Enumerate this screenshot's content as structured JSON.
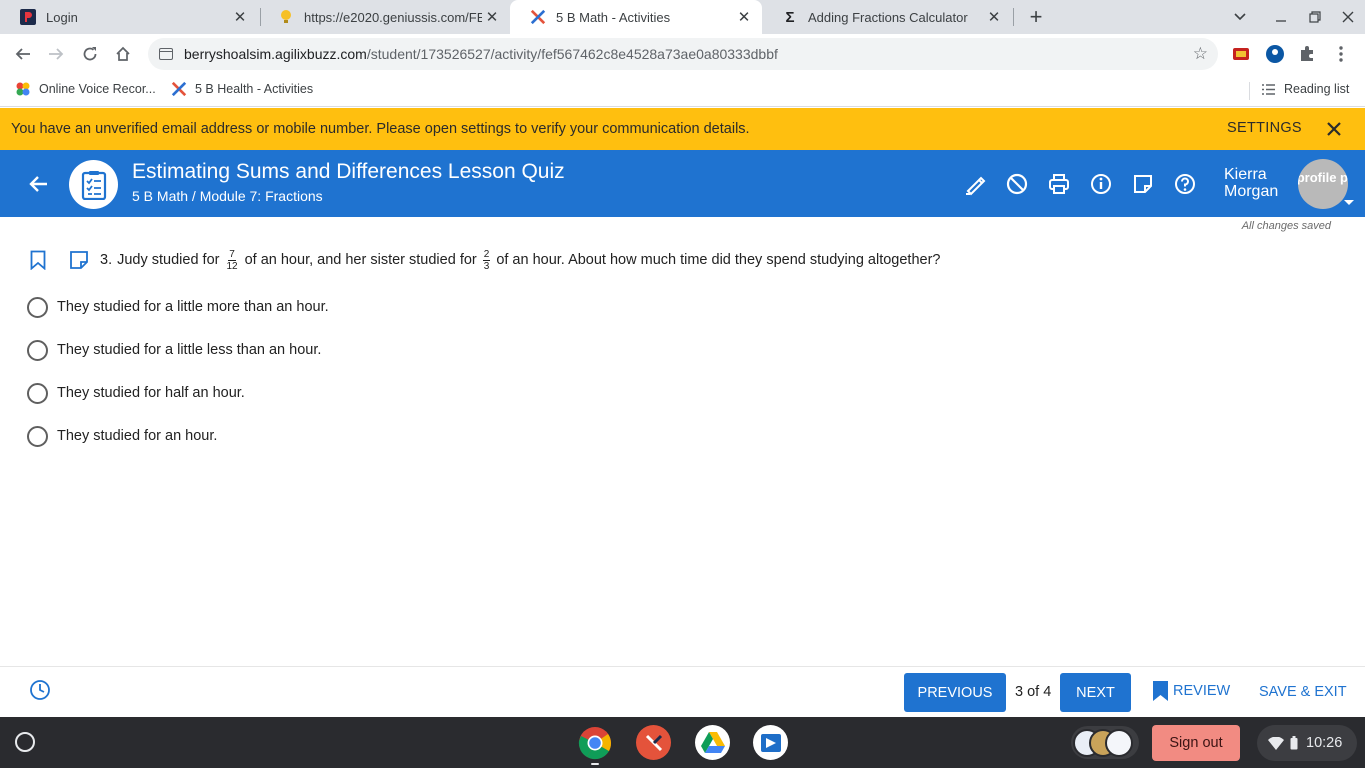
{
  "browser": {
    "tabs": [
      {
        "title": "Login",
        "active": false
      },
      {
        "title": "https://e2020.geniussis.com/FEI",
        "active": false
      },
      {
        "title": "5 B Math - Activities",
        "active": true
      },
      {
        "title": "Adding Fractions Calculator",
        "active": false
      }
    ],
    "address": {
      "host": "berryshoalsim.agilixbuzz.com",
      "path": "/student/173526527/activity/fef567462c8e4528a73ae0a80333dbbf"
    },
    "bookmarks": [
      {
        "label": "Online Voice Recor..."
      },
      {
        "label": "5 B Health - Activities"
      }
    ],
    "reading_list": "Reading list"
  },
  "notice": {
    "text": "You have an unverified email address or mobile number. Please open settings to verify your communication details.",
    "settings_label": "SETTINGS"
  },
  "header": {
    "title": "Estimating Sums and Differences Lesson Quiz",
    "breadcrumb": "5 B Math / Module 7: Fractions",
    "user_first": "Kierra",
    "user_last": "Morgan",
    "avatar_text": "profile p"
  },
  "status": {
    "saved": "All changes saved"
  },
  "question": {
    "number": "3.",
    "part1": "Judy studied for",
    "frac1_num": "7",
    "frac1_den": "12",
    "part2": "of an hour, and her sister studied for",
    "frac2_num": "2",
    "frac2_den": "3",
    "part3": "of an hour. About how much time did they spend studying altogether?",
    "options": [
      "They studied for a little more than an hour.",
      "They studied for a little less than an hour.",
      "They studied for half an hour.",
      "They studied for an hour."
    ]
  },
  "footer": {
    "previous": "PREVIOUS",
    "position": "3 of 4",
    "next": "NEXT",
    "review": "REVIEW",
    "save_exit": "SAVE & EXIT"
  },
  "shelf": {
    "sign_out": "Sign out",
    "time": "10:26"
  },
  "colors": {
    "brand_blue": "#1f73d0",
    "notice_yellow": "#ffbf0f",
    "sign_out": "#f28b82"
  }
}
